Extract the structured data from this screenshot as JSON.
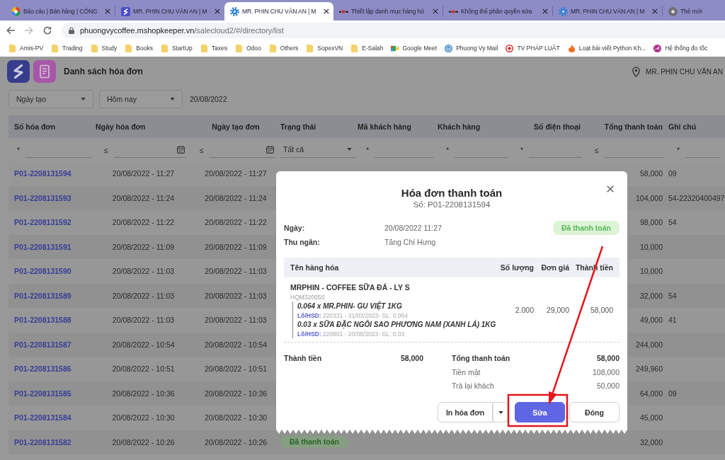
{
  "browser": {
    "tabs": [
      {
        "title": "Báo cáo | Bán hàng | CÔNG",
        "kind": "report",
        "selected": false,
        "closable": true
      },
      {
        "title": "MR. PHIN CHU VĂN AN | M",
        "kind": "shop",
        "selected": false,
        "closable": true
      },
      {
        "title": "MR. PHIN CHU VĂN AN | M",
        "kind": "gear",
        "selected": true,
        "closable": true
      },
      {
        "title": "Thiết lập danh mục hàng hó",
        "kind": "wordmark",
        "selected": false,
        "closable": true
      },
      {
        "title": "Không thể phân quyền sửa",
        "kind": "wordmark",
        "selected": false,
        "closable": true
      },
      {
        "title": "MR. PHIN CHU VĂN AN | M",
        "kind": "gear",
        "selected": false,
        "closable": true
      },
      {
        "title": "Thẻ mới",
        "kind": "newtab",
        "selected": false,
        "closable": false
      }
    ],
    "address": {
      "host": "phuongvycoffee.mshopkeeper.vn",
      "path": "/salecloud2/#/directory/list"
    },
    "bookmarks": [
      {
        "label": "Amis-PV",
        "kind": "folder"
      },
      {
        "label": "Trading",
        "kind": "folder"
      },
      {
        "label": "Study",
        "kind": "folder"
      },
      {
        "label": "Books",
        "kind": "folder"
      },
      {
        "label": "StartUp",
        "kind": "folder"
      },
      {
        "label": "Taxes",
        "kind": "folder"
      },
      {
        "label": "Odoo",
        "kind": "folder"
      },
      {
        "label": "Others",
        "kind": "folder"
      },
      {
        "label": "SopexVN",
        "kind": "folder"
      },
      {
        "label": "E-Salah",
        "kind": "folder"
      },
      {
        "label": "Google Meet",
        "kind": "video"
      },
      {
        "label": "Phuong Vy Mail",
        "kind": "blog"
      },
      {
        "label": "TV PHÁP LUẬT",
        "kind": "news"
      },
      {
        "label": "Loạt bài viết Python Kh...",
        "kind": "flame"
      },
      {
        "label": "Hệ thống đo tốc",
        "kind": "gauge"
      }
    ]
  },
  "app": {
    "title": "Danh sách hóa đơn",
    "store": "MR. PHIN CHU VĂN AN"
  },
  "filters": {
    "date_field": "Ngày tạo",
    "period": "Hôm nay",
    "date": "20/08/2022"
  },
  "table": {
    "columns": [
      "Số hóa đơn",
      "Ngày hóa đơn",
      "Ngày tạo đơn",
      "Trạng thái",
      "Mã khách hàng",
      "Khách hàng",
      "Số điện thoại",
      "Tổng thanh toán",
      "Ghi chú"
    ],
    "filters": [
      {
        "kind": "text",
        "operator": "*"
      },
      {
        "kind": "date",
        "operator": "≤"
      },
      {
        "kind": "date",
        "operator": "≤"
      },
      {
        "kind": "select",
        "value": "Tất cả"
      },
      {
        "kind": "text",
        "operator": "*"
      },
      {
        "kind": "text",
        "operator": "*"
      },
      {
        "kind": "text",
        "operator": "*"
      },
      {
        "kind": "text",
        "operator": "≤"
      },
      {
        "kind": "text",
        "operator": "*"
      }
    ],
    "rows": [
      {
        "number": "P01-2208131594",
        "invoice_date": "20/08/2022 - 11:27",
        "created": "20/08/2022 - 11:27",
        "total": "58,000",
        "note": "09"
      },
      {
        "number": "P01-2208131593",
        "invoice_date": "20/08/2022 - 11:24",
        "created": "20/08/2022 - 11:24",
        "total": "104,000",
        "note": "54-22320400497"
      },
      {
        "number": "P01-2208131592",
        "invoice_date": "20/08/2022 - 11:22",
        "created": "20/08/2022 - 11:22",
        "total": "98,000",
        "note": "54"
      },
      {
        "number": "P01-2208131591",
        "invoice_date": "20/08/2022 - 11:09",
        "created": "20/08/2022 - 11:09",
        "total": "10,000"
      },
      {
        "number": "P01-2208131590",
        "invoice_date": "20/08/2022 - 11:03",
        "created": "20/08/2022 - 11:03",
        "total": "10,000"
      },
      {
        "number": "P01-2208131589",
        "invoice_date": "20/08/2022 - 11:03",
        "created": "20/08/2022 - 11:03",
        "total": "32,000",
        "note": "54"
      },
      {
        "number": "P01-2208131588",
        "invoice_date": "20/08/2022 - 11:03",
        "created": "20/08/2022 - 11:03",
        "total": "49,000",
        "note": "41"
      },
      {
        "number": "P01-2208131587",
        "invoice_date": "20/08/2022 - 10:54",
        "created": "20/08/2022 - 10:54",
        "total": "244,000"
      },
      {
        "number": "P01-2208131586",
        "invoice_date": "20/08/2022 - 10:51",
        "created": "20/08/2022 - 10:51",
        "total": "249,960"
      },
      {
        "number": "P01-2208131585",
        "invoice_date": "20/08/2022 - 10:36",
        "created": "20/08/2022 - 10:36",
        "total": "64,000",
        "note": "09"
      },
      {
        "number": "P01-2208131584",
        "invoice_date": "20/08/2022 - 10:30",
        "created": "20/08/2022 - 10:30",
        "total": "45,000"
      },
      {
        "number": "P01-2208131582",
        "invoice_date": "20/08/2022 - 10:26",
        "created": "20/08/2022 - 10:26",
        "status": "Đã thanh toán",
        "total": "32,000"
      }
    ]
  },
  "dialog": {
    "title": "Hóa đơn thanh toán",
    "number": "Số: P01-2208131594",
    "fields": [
      {
        "label": "Ngày:",
        "value": "20/08/2022 11:27"
      },
      {
        "label": "Thu ngân:",
        "value": "Tăng Chí Hưng"
      }
    ],
    "status": "Đã thanh toán",
    "columns": [
      "Tên hàng hóa",
      "Số lượng",
      "Đơn giá",
      "Thành tiền"
    ],
    "items": [
      {
        "name": "MRPHIN - COFFEE SỮA ĐÁ - LY S",
        "code": "HQM32005S",
        "components": [
          {
            "name": "0.064 x MR.PHIN- GU VIỆT 1KG",
            "lot_label": "Lô/HSD:",
            "lot": "220331 - 31/03/2023- SL: 0.064"
          },
          {
            "name": "0.03 x SỮA ĐẶC NGÔI SAO PHƯƠNG NAM (XANH LÁ) 1KG",
            "lot_label": "Lô/HSD:",
            "lot": "220801 - 20/06/2023- SL: 0.03"
          }
        ],
        "quantity": "2.000",
        "price": "29,000",
        "amount": "58,000"
      }
    ],
    "subtotal": {
      "label": "Thành tiền",
      "value": "58,000"
    },
    "totals": [
      {
        "kind": "total",
        "label": "Tổng thanh toán",
        "value": "58,000"
      },
      {
        "kind": "line",
        "label": "Tiền mặt",
        "value": "108,000"
      },
      {
        "kind": "line",
        "label": "Trả lại khách",
        "value": "50,000"
      }
    ],
    "buttons": {
      "print": "In hóa đơn",
      "edit": "Sửa",
      "close": "Đóng"
    }
  }
}
